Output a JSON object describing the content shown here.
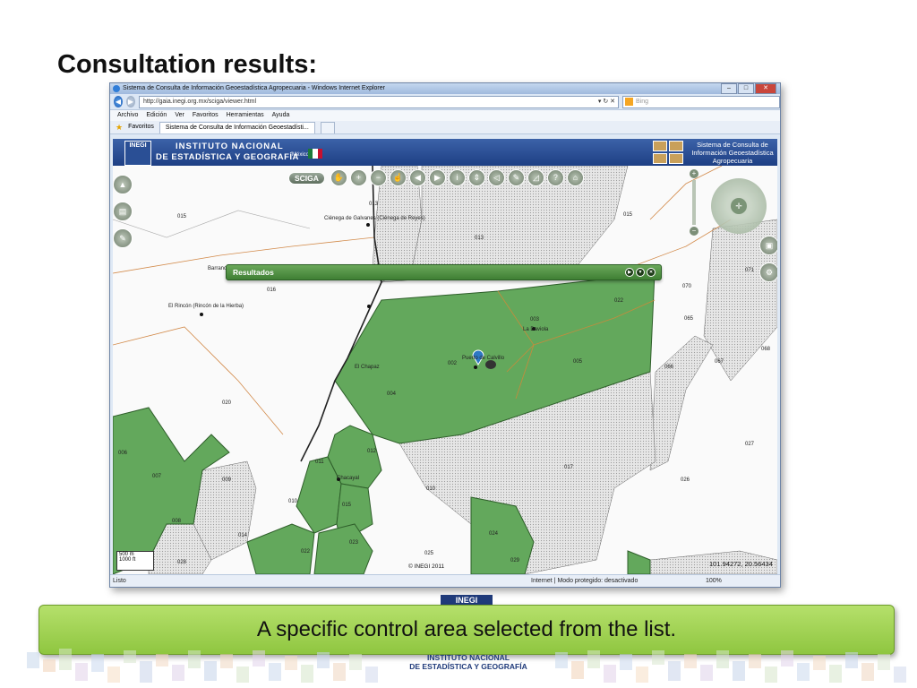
{
  "slide": {
    "title": "Consultation results:",
    "caption": "A specific control area selected from the list.",
    "bottom_logo_line1": "INSTITUTO NACIONAL",
    "bottom_logo_line2": "DE ESTADÍSTICA Y GEOGRAFÍA",
    "bottom_logo_mark": "INEGI"
  },
  "browser": {
    "window_title": "Sistema de Consulta de Información Geoestadística Agropecuaria - Windows Internet Explorer",
    "url": "http://gaia.inegi.org.mx/sciga/viewer.html",
    "search_placeholder": "Bing",
    "menu": [
      "Archivo",
      "Edición",
      "Ver",
      "Favoritos",
      "Herramientas",
      "Ayuda"
    ],
    "favorites_label": "Favoritos",
    "tab_label": "Sistema de Consulta de Información Geoestadísti...",
    "status_ready": "Listo",
    "status_zone": "Internet | Modo protegido: desactivado",
    "status_zoom": "100%"
  },
  "app": {
    "logo_text": "INEGI",
    "org_line1": "INSTITUTO NACIONAL",
    "org_line2": "DE ESTADÍSTICA Y GEOGRAFÍA",
    "country": "México",
    "system_name": "Sistema de Consulta de Información Geoestadística Agropecuaria",
    "sciga_button": "SCIGA",
    "results_panel_title": "Resultados",
    "copyright": "© INEGI 2011",
    "coordinates": "101.94272, 20.56434",
    "scale_500": "500 m",
    "scale_1000": "1000 ft"
  },
  "map_labels": {
    "l015a": "015",
    "l013a": "013",
    "l015b": "015",
    "l013b": "013",
    "cienega": "Ciénega de Galvanes (Ciénega de Reyes)",
    "barranca": "Barranca",
    "l016": "016",
    "l071": "071",
    "l070": "070",
    "rincon": "El Rincón (Rincón de la Hierba)",
    "l022": "022",
    "l065": "065",
    "l066": "066",
    "l067": "067",
    "l068": "068",
    "l003": "003",
    "l004": "004",
    "l005": "005",
    "ladaviola": "La Daviola",
    "puertocalvillo": "Puerto de Calvillo",
    "elchapaz": "El Chapaz",
    "l020": "020",
    "l027": "027",
    "l006": "006",
    "l007": "007",
    "l009": "009",
    "l011": "011",
    "l012": "012",
    "l017": "017",
    "l010a": "010",
    "l010b": "010",
    "l015c": "015",
    "l026": "026",
    "chacayal": "Chacayal",
    "l008": "008",
    "l014": "014",
    "l022b": "022",
    "l023": "023",
    "l025": "025",
    "l028": "028",
    "l029": "029",
    "l002": "002",
    "l024": "024"
  },
  "colors": {
    "selected_area": "#63a85c",
    "header_blue": "#2a4f95",
    "caption_green": "#9fd254"
  }
}
